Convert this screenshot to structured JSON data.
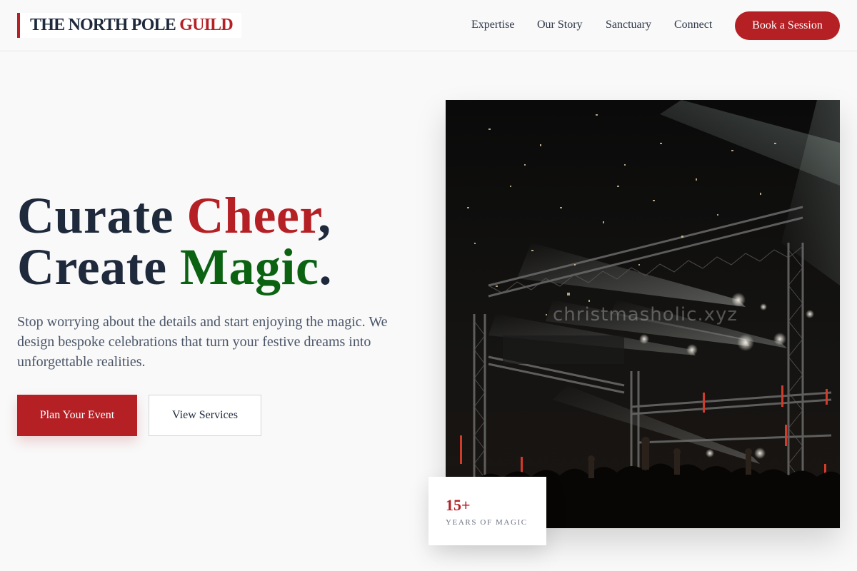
{
  "header": {
    "logo_main": "THE NORTH POLE ",
    "logo_accent": "GUILD",
    "nav": [
      {
        "label": "Expertise"
      },
      {
        "label": "Our Story"
      },
      {
        "label": "Sanctuary"
      },
      {
        "label": "Connect"
      }
    ],
    "cta_label": "Book a Session"
  },
  "hero": {
    "headline_line1_a": "Curate ",
    "headline_line1_b": "Cheer",
    "headline_line1_c": ",",
    "headline_line2_a": "Create ",
    "headline_line2_b": "Magic",
    "headline_line2_c": ".",
    "subtext": "Stop worrying about the details and start enjoying the magic. We design bespoke celebrations that turn your festive dreams into unforgettable realities.",
    "primary_button": "Plan Your Event",
    "secondary_button": "View Services"
  },
  "image": {
    "watermark": "christmasholic.xyz"
  },
  "stat": {
    "value": "15+",
    "label": "YEARS OF MAGIC"
  },
  "colors": {
    "accent_red": "#b52025",
    "accent_green": "#0b6312",
    "ink": "#1e293b",
    "background": "#f9f9f9"
  }
}
